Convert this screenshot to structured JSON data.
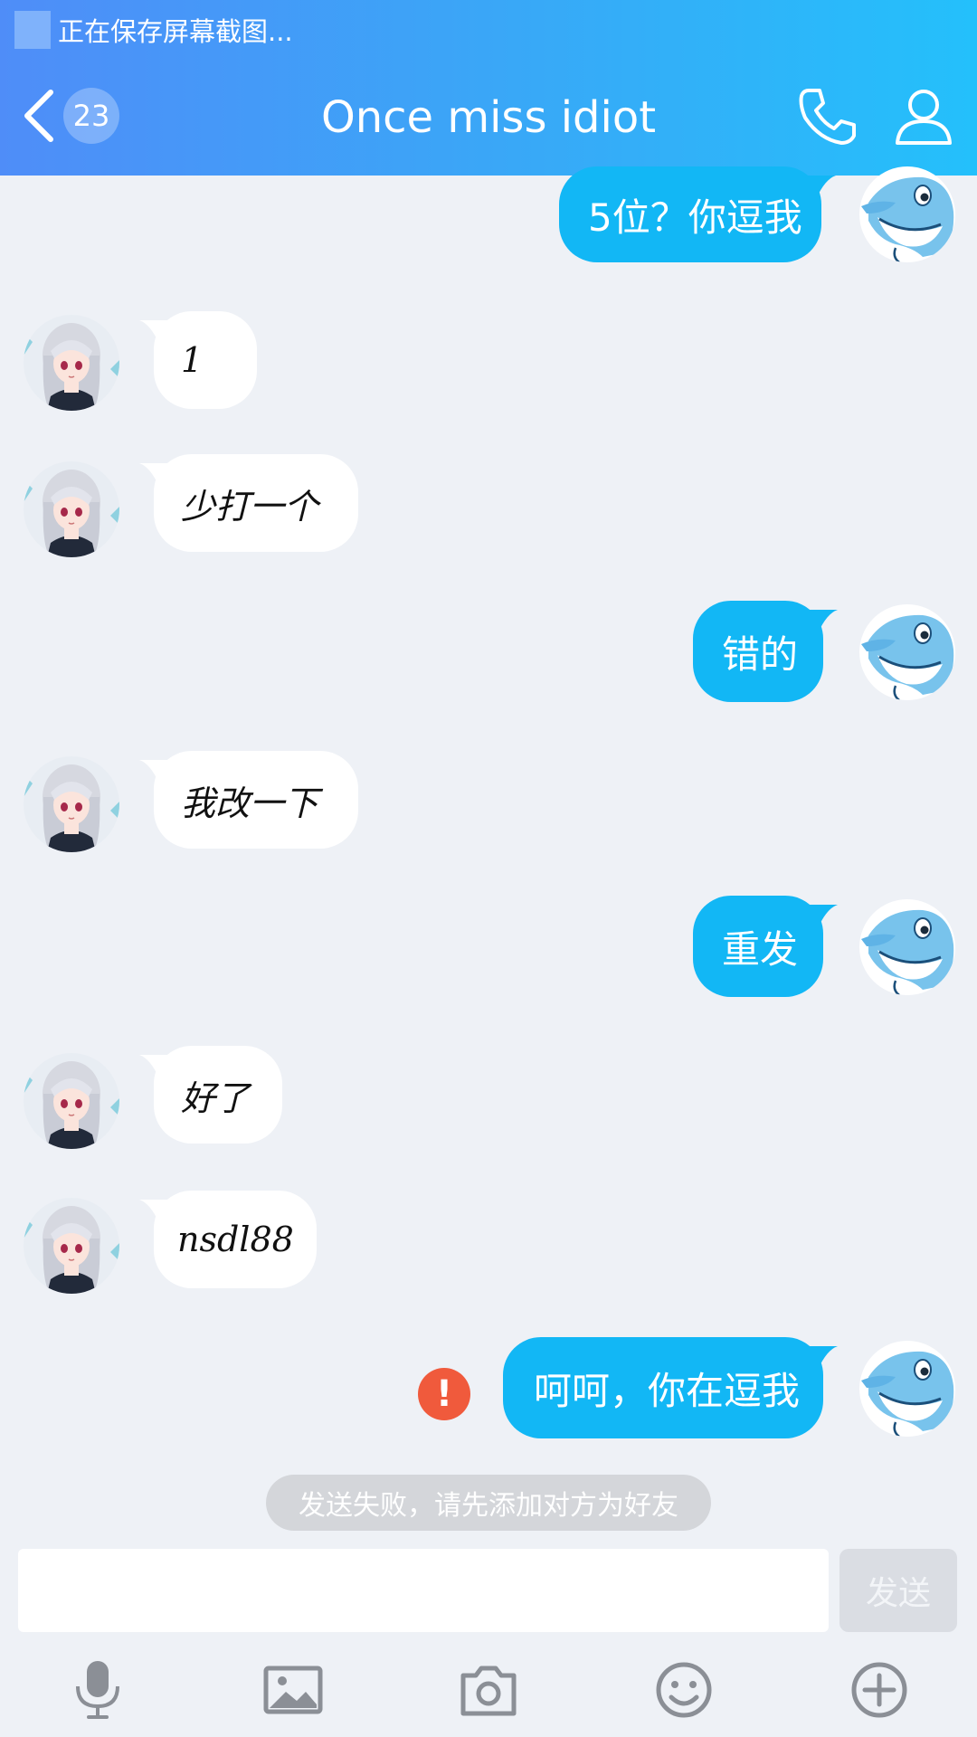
{
  "status_bar": {
    "text": "正在保存屏幕截图..."
  },
  "header": {
    "unread_count": "23",
    "title": "Once miss idiot",
    "back_icon": "chevron-left-icon",
    "call_icon": "phone-icon",
    "profile_icon": "person-icon"
  },
  "messages": [
    {
      "side": "out",
      "text": "5位？你逗我"
    },
    {
      "side": "in",
      "text": "1"
    },
    {
      "side": "in",
      "text": "少打一个"
    },
    {
      "side": "out",
      "text": "错的"
    },
    {
      "side": "in",
      "text": "我改一下"
    },
    {
      "side": "out",
      "text": "重发"
    },
    {
      "side": "in",
      "text": "好了"
    },
    {
      "side": "in",
      "text": "nsdl88"
    },
    {
      "side": "out",
      "text": "呵呵，你在逗我",
      "failed": true
    }
  ],
  "error_icon": "!",
  "notice": "发送失败，请先添加对方为好友",
  "input": {
    "value": "",
    "send_label": "发送"
  },
  "toolbar": [
    "microphone-icon",
    "image-icon",
    "camera-icon",
    "emoji-icon",
    "plus-icon"
  ],
  "colors": {
    "header_start": "#4f8df8",
    "header_end": "#24c0fb",
    "outgoing_bubble": "#12b7f5",
    "incoming_bubble": "#ffffff",
    "background": "#eef1f6",
    "error": "#f05a3c"
  }
}
